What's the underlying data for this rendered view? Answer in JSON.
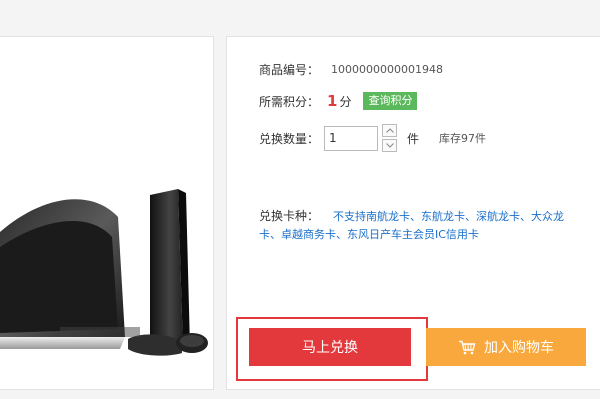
{
  "product": {
    "sku_label": "商品编号：",
    "sku_value": "1000000000001948",
    "points_label": "所需积分：",
    "points_value": "1",
    "points_unit": "分",
    "query_points_label": "查询积分",
    "quantity_label": "兑换数量：",
    "quantity_value": "1",
    "quantity_unit": "件",
    "stock_text": "库存97件",
    "cards_label": "兑换卡种：",
    "cards": [
      "不支持南航龙卡",
      "东航龙卡",
      "深航龙卡",
      "大众龙卡",
      "卓越商务卡",
      "东风日产车主会员IC信用卡"
    ],
    "card_separator": "、"
  },
  "actions": {
    "redeem_label": "马上兑换",
    "add_to_cart_label": "加入购物车"
  },
  "icons": [
    "chevron-up-icon",
    "chevron-down-icon",
    "shopping-cart-icon"
  ],
  "colors": {
    "accent_red": "#e4393c",
    "query_green": "#5cb85c",
    "cart_orange": "#f8a83c",
    "link_blue": "#1a6fc9"
  }
}
